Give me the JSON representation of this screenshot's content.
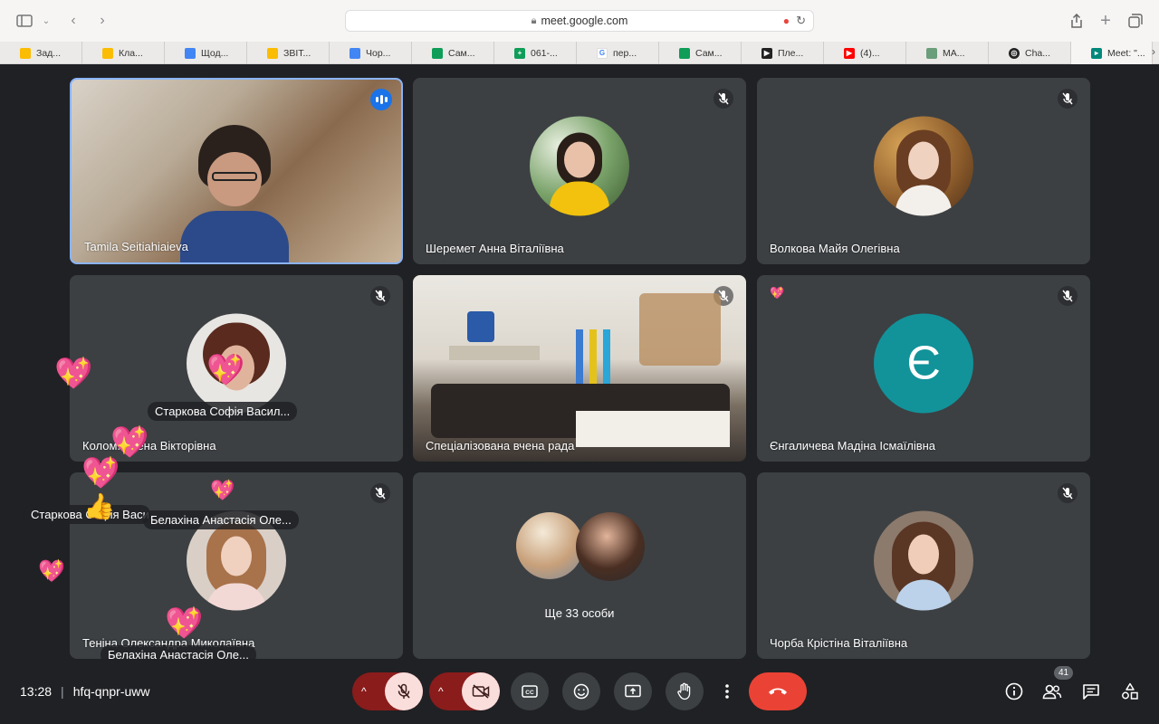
{
  "browser": {
    "url": "meet.google.com",
    "tabs": [
      {
        "label": "Зад...",
        "color": "#fbbc04"
      },
      {
        "label": "Кла...",
        "color": "#fbbc04"
      },
      {
        "label": "Щод...",
        "color": "#4285f4"
      },
      {
        "label": "ЗВІТ...",
        "color": "#fbbc04"
      },
      {
        "label": "Чор...",
        "color": "#4285f4"
      },
      {
        "label": "Сам...",
        "color": "#0f9d58"
      },
      {
        "label": "061-...",
        "color": "#0f9d58"
      },
      {
        "label": "пер...",
        "color": "#4285f4"
      },
      {
        "label": "Сам...",
        "color": "#0f9d58"
      },
      {
        "label": "Пле...",
        "color": "#222222"
      },
      {
        "label": "(4)...",
        "color": "#ff0000"
      },
      {
        "label": "МА...",
        "color": "#6b9e7b"
      },
      {
        "label": "Cha...",
        "color": "#222222"
      },
      {
        "label": "Meet: \"...",
        "color": "#00897b"
      }
    ]
  },
  "participants": [
    {
      "name": "Tamila Seitiahiaieva"
    },
    {
      "name": "Шеремет Анна Віталіївна"
    },
    {
      "name": "Волкова Майя Олегівна"
    },
    {
      "name": "Колом... лена Вікторівна"
    },
    {
      "name": "Спеціалізована вчена рада"
    },
    {
      "name": "Єнгаличева Мадіна Ісмаїлівна",
      "initial": "Є"
    },
    {
      "name": "Теніна Олександра Миколаївна"
    },
    {
      "name": "Ще 33 особи"
    },
    {
      "name": "Чорба Крістіна Віталіївна"
    }
  ],
  "floating_labels": [
    "Старкова Софія Васил...",
    "Старкова Софія Васи...",
    "Белахіна Анастасія Оле...",
    "Белахіна Анастасія Оле..."
  ],
  "meeting": {
    "time": "13:28",
    "code": "hfq-qnpr-uww",
    "participant_count": "41"
  },
  "colors": {
    "end_call": "#ea4335",
    "speaking": "#1a73e8",
    "initial_avatar": "#12939a"
  }
}
